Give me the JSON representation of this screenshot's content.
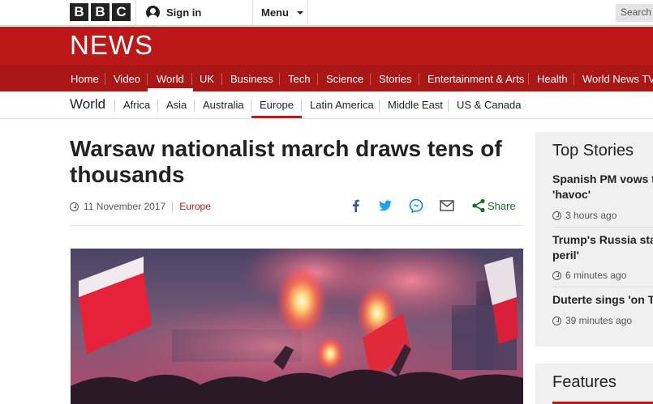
{
  "header": {
    "logo_letters": [
      "B",
      "B",
      "C"
    ],
    "signin_label": "Sign in",
    "menu_label": "Menu",
    "search_placeholder": "Search"
  },
  "banner": {
    "title": "NEWS",
    "color": "#bb1919"
  },
  "nav": {
    "items": [
      "Home",
      "Video",
      "World",
      "UK",
      "Business",
      "Tech",
      "Science",
      "Stories",
      "Entertainment & Arts",
      "Health",
      "World News TV"
    ],
    "active": "World"
  },
  "subnav": {
    "section": "World",
    "items": [
      "Africa",
      "Asia",
      "Australia",
      "Europe",
      "Latin America",
      "Middle East",
      "US & Canada"
    ],
    "active": "Europe"
  },
  "article": {
    "headline": "Warsaw nationalist march draws tens of thousands",
    "date": "11 November 2017",
    "section": "Europe",
    "share_label": "Share",
    "share_icons": [
      "facebook-icon",
      "twitter-icon",
      "messenger-icon",
      "email-icon",
      "share-icon"
    ]
  },
  "sidebar": {
    "top_stories_title": "Top Stories",
    "stories": [
      {
        "title_line1": "Spanish PM vows t",
        "title_line2": "'havoc'",
        "time": "3 hours ago"
      },
      {
        "title_line1": "Trump's Russia sta",
        "title_line2": "peril'",
        "time": "6 minutes ago"
      },
      {
        "title_line1": "Duterte sings 'on T",
        "title_line2": "",
        "time": "39 minutes ago"
      }
    ],
    "features_title": "Features"
  }
}
